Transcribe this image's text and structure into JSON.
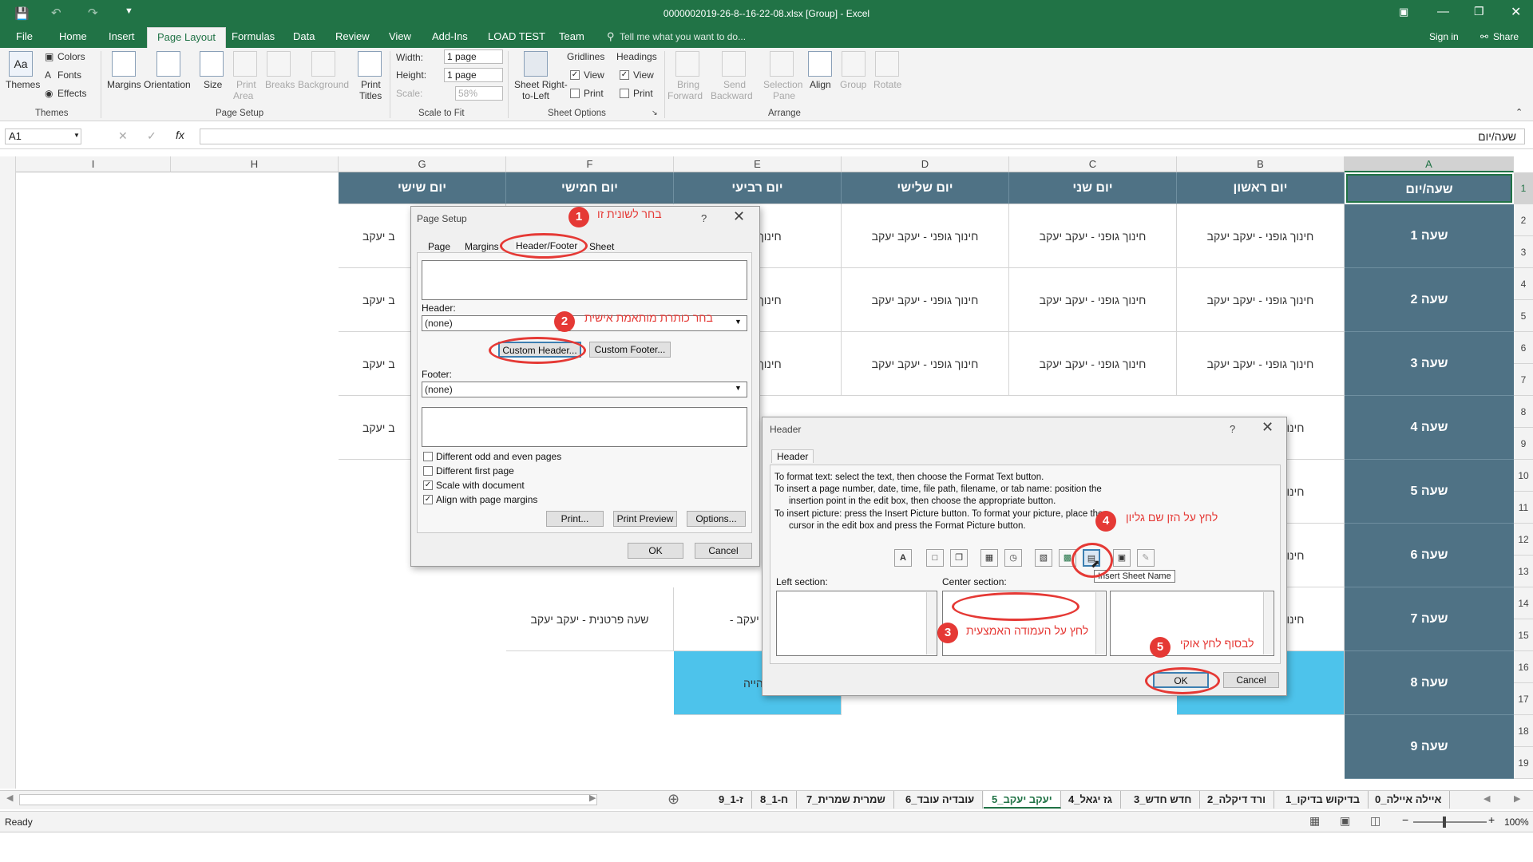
{
  "window": {
    "title": "0000002019-26-8--16-22-08.xlsx [Group] - Excel",
    "signin": "Sign in",
    "share": "Share"
  },
  "ribbon_tabs": [
    "File",
    "Home",
    "Insert",
    "Page Layout",
    "Formulas",
    "Data",
    "Review",
    "View",
    "Add-Ins",
    "LOAD TEST",
    "Team"
  ],
  "active_tab": "Page Layout",
  "tell_me": "Tell me what you want to do...",
  "ribbon": {
    "themes": {
      "themes": "Themes",
      "colors": "Colors",
      "fonts": "Fonts",
      "effects": "Effects",
      "group": "Themes"
    },
    "page_setup": {
      "margins": "Margins",
      "orientation": "Orientation",
      "size": "Size",
      "print_area_1": "Print",
      "print_area_2": "Area",
      "breaks": "Breaks",
      "background": "Background",
      "print_titles_1": "Print",
      "print_titles_2": "Titles",
      "group": "Page Setup"
    },
    "scale": {
      "width_label": "Width:",
      "width_value": "1 page",
      "height_label": "Height:",
      "height_value": "1 page",
      "scale_label": "Scale:",
      "scale_value": "58%",
      "group": "Scale to Fit"
    },
    "sheet_options": {
      "rtl_1": "Sheet Right-",
      "rtl_2": "to-Left",
      "gridlines": "Gridlines",
      "headings": "Headings",
      "view": "View",
      "print": "Print",
      "group": "Sheet Options"
    },
    "arrange": {
      "bring_1": "Bring",
      "bring_2": "Forward",
      "send_1": "Send",
      "send_2": "Backward",
      "sel_1": "Selection",
      "sel_2": "Pane",
      "align": "Align",
      "group_btn": "Group",
      "rotate": "Rotate",
      "group": "Arrange"
    }
  },
  "formula_bar": {
    "name_box": "A1",
    "value": "שעה/יום"
  },
  "columns": [
    "I",
    "H",
    "G",
    "F",
    "E",
    "D",
    "C",
    "B",
    "A"
  ],
  "row_numbers": [
    "1",
    "2",
    "3",
    "4",
    "5",
    "6",
    "7",
    "8",
    "9",
    "10",
    "11",
    "12",
    "13",
    "14",
    "15",
    "16",
    "17",
    "18",
    "19"
  ],
  "sheet": {
    "header_row": [
      "יום שישי",
      "יום חמישי",
      "יום רביעי",
      "יום שלישי",
      "יום שני",
      "יום ראשון",
      "שעה/יום"
    ],
    "hours": [
      "שעה 1",
      "שעה 2",
      "שעה 3",
      "שעה 4",
      "שעה 5",
      "שעה 6",
      "שעה 7",
      "שעה 8",
      "שעה 9"
    ],
    "pe": "חינוך גופני - יעקב יעקב",
    "pe_cut_g": "ב יעקב",
    "pe_cut_e": "חינוך גופני",
    "pe_cut_b": "חינוך",
    "private": "שעה פרטנית - יעקב יעקב",
    "private_cut_e": "- יעקב יעקב",
    "break_cut": "שהייה"
  },
  "sheet_tabs": [
    "0_איילה איילה",
    "1_בדיקוש בדיקו",
    "2_ורד דיקלה",
    "3_חדש חדש",
    "4_גז יגאל",
    "5_יעקב יעקב",
    "6_עובדיה עובד",
    "7_שמרית שמרית",
    "8_ח-1",
    "9_ז-1"
  ],
  "active_sheet": "5_יעקב יעקב",
  "status": {
    "ready": "Ready",
    "zoom": "100%"
  },
  "page_setup_dialog": {
    "title": "Page Setup",
    "help": "?",
    "tabs": [
      "Page",
      "Margins",
      "Header/Footer",
      "Sheet"
    ],
    "header_label": "Header:",
    "header_value": "(none)",
    "custom_header": "Custom Header...",
    "custom_footer": "Custom Footer...",
    "footer_label": "Footer:",
    "footer_value": "(none)",
    "checks": [
      "Different odd and even pages",
      "Different first page",
      "Scale with document",
      "Align with page margins"
    ],
    "checked": [
      false,
      false,
      true,
      true
    ],
    "print": "Print...",
    "print_preview": "Print Preview",
    "options": "Options...",
    "ok": "OK",
    "cancel": "Cancel"
  },
  "header_dialog": {
    "title": "Header",
    "help": "?",
    "tab": "Header",
    "line1": "To format text:  select the text, then choose the Format Text button.",
    "line2": "To insert a page number, date, time, file path, filename, or tab name:  position the",
    "line3": "insertion point in the edit box, then choose the appropriate button.",
    "line4": "To insert picture: press the Insert Picture button.  To format your picture, place the",
    "line5": "cursor in the edit box and press the Format Picture button.",
    "left": "Left section:",
    "center": "Center section:",
    "right_cut": "R",
    "tooltip": "Insert Sheet Name",
    "ok": "OK",
    "cancel": "Cancel"
  },
  "annotations": {
    "n1": "1",
    "t1": "בחר לשונית זו",
    "n2": "2",
    "t2": "בחר כותרת מותאמת אישית",
    "n3": "3",
    "t3": "לחץ על העמודה האמצעית",
    "n4": "4",
    "t4": "לחץ על הזן שם גליון",
    "n5": "5",
    "t5": "לבסוף לחץ אוקי",
    "color": "#e53935"
  }
}
